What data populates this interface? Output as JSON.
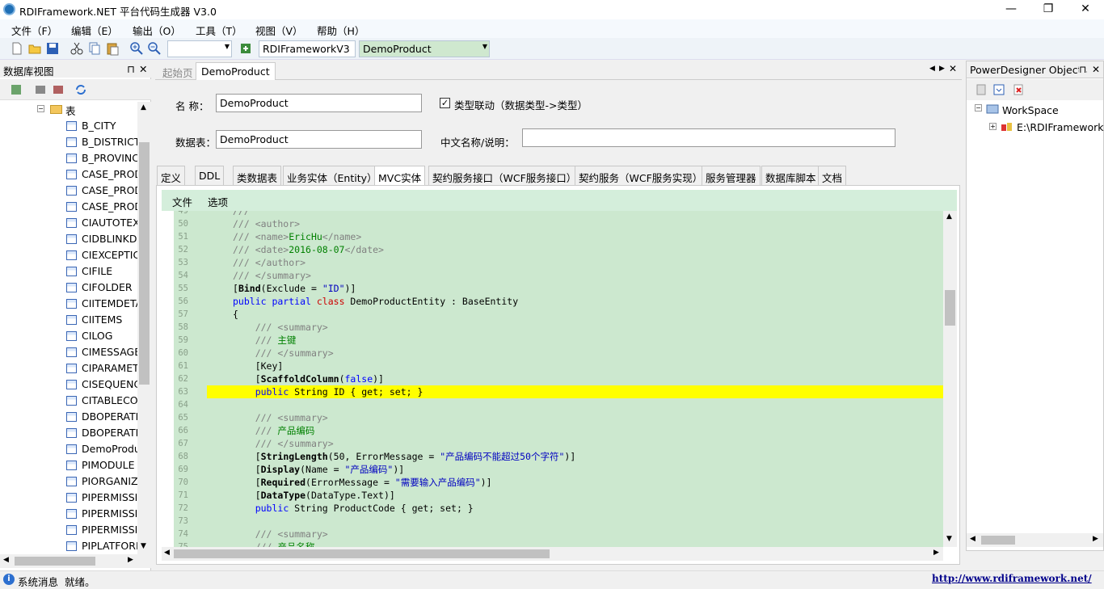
{
  "window": {
    "title": "RDIFramework.NET 平台代码生成器 V3.0",
    "minimize": "—",
    "maximize": "❐",
    "close": "✕"
  },
  "menu": [
    "文件（F）",
    "编辑（E）",
    "输出（O）",
    "工具（T）",
    "视图（V）",
    "帮助（H）"
  ],
  "toolbar": {
    "project_combo": "RDIFrameworkV3",
    "table_combo": "DemoProduct",
    "zoom_combo": ""
  },
  "left_panel": {
    "title": "数据库视图",
    "folder_label": "表",
    "tables": [
      "B_CITY",
      "B_DISTRICT",
      "B_PROVINC",
      "CASE_PROD",
      "CASE_PROD",
      "CASE_PROD",
      "CIAUTOTEX",
      "CIDBLINKDI",
      "CIEXCEPTIC",
      "CIFILE",
      "CIFOLDER",
      "CIITEMDETA",
      "CIITEMS",
      "CILOG",
      "CIMESSAGE",
      "CIPARAMET",
      "CISEQUENC",
      "CITABLECOI",
      "DBOPERATI",
      "DBOPERATI",
      "DemoProdu",
      "PIMODULE",
      "PIORGANIZ",
      "PIPERMISSI",
      "PIPERMISSI",
      "PIPERMISSI",
      "PIPLATFORN"
    ]
  },
  "doc_tabs": [
    "起始页",
    "DemoProduct"
  ],
  "form": {
    "name_label": "名 称：",
    "name_value": "DemoProduct",
    "checkbox_label": "类型联动（数据类型->类型）",
    "checkbox_checked": true,
    "table_label": "数据表：",
    "table_value": "DemoProduct",
    "desc_label": "中文名称/说明：",
    "desc_value": ""
  },
  "sub_tabs": [
    "定义",
    "DDL",
    "类数据表",
    "业务实体（Entity）",
    "MVC实体",
    "契约服务接口（WCF服务接口）",
    "契约服务（WCF服务实现）",
    "服务管理器",
    "数据库脚本",
    "文档"
  ],
  "active_sub_tab": "MVC实体",
  "editor_menu": [
    "文件",
    "选项"
  ],
  "code_lines": [
    {
      "n": "49",
      "html": "<span class='c-cm'>///</span>"
    },
    {
      "n": "50",
      "html": "<span class='c-cm'>/// &lt;author&gt;</span>"
    },
    {
      "n": "51",
      "html": "<span class='c-cm'>/// &lt;name&gt;</span><span class='c-zh'>EricHu</span><span class='c-cm'>&lt;/name&gt;</span>"
    },
    {
      "n": "52",
      "html": "<span class='c-cm'>/// &lt;date&gt;</span><span class='c-zh'>2016-08-07</span><span class='c-cm'>&lt;/date&gt;</span>"
    },
    {
      "n": "53",
      "html": "<span class='c-cm'>/// &lt;/author&gt;</span>"
    },
    {
      "n": "54",
      "html": "<span class='c-cm'>/// &lt;/summary&gt;</span>"
    },
    {
      "n": "55",
      "html": "[<span class='c-bold'>Bind</span>(Exclude = <span class='c-str'>\"ID\"</span>)]"
    },
    {
      "n": "56",
      "html": "<span class='c-kw'>public partial</span> <span class='c-cls'>class</span> DemoProductEntity : BaseEntity"
    },
    {
      "n": "57",
      "html": "{"
    },
    {
      "n": "58",
      "html": "    <span class='c-cm'>/// &lt;summary&gt;</span>"
    },
    {
      "n": "59",
      "html": "    <span class='c-cm'>///</span> <span class='c-zh'>主键</span>"
    },
    {
      "n": "60",
      "html": "    <span class='c-cm'>/// &lt;/summary&gt;</span>"
    },
    {
      "n": "61",
      "html": "    [Key]"
    },
    {
      "n": "62",
      "html": "    [<span class='c-bold'>ScaffoldColumn</span>(<span class='c-kw'>false</span>)]"
    },
    {
      "n": "63",
      "html": "    <span class='c-kw'>public</span> String ID { get; set; }",
      "highlight": true
    },
    {
      "n": "64",
      "html": ""
    },
    {
      "n": "65",
      "html": "    <span class='c-cm'>/// &lt;summary&gt;</span>"
    },
    {
      "n": "66",
      "html": "    <span class='c-cm'>///</span> <span class='c-zh'>产品编码</span>"
    },
    {
      "n": "67",
      "html": "    <span class='c-cm'>/// &lt;/summary&gt;</span>"
    },
    {
      "n": "68",
      "html": "    [<span class='c-bold'>StringLength</span>(50, ErrorMessage = <span class='c-str'>\"产品编码不能超过50个字符\"</span>)]"
    },
    {
      "n": "69",
      "html": "    [<span class='c-bold'>Display</span>(Name = <span class='c-str'>\"产品编码\"</span>)]"
    },
    {
      "n": "70",
      "html": "    [<span class='c-bold'>Required</span>(ErrorMessage = <span class='c-str'>\"需要输入产品编码\"</span>)]"
    },
    {
      "n": "71",
      "html": "    [<span class='c-bold'>DataType</span>(DataType.Text)]"
    },
    {
      "n": "72",
      "html": "    <span class='c-kw'>public</span> String ProductCode { get; set; }"
    },
    {
      "n": "73",
      "html": ""
    },
    {
      "n": "74",
      "html": "    <span class='c-cm'>/// &lt;summary&gt;</span>"
    },
    {
      "n": "75",
      "html": "    <span class='c-cm'>///</span> <span class='c-zh'>产品名称</span>"
    }
  ],
  "right_panel": {
    "title": "PowerDesigner Objects",
    "workspace": "WorkSpace",
    "file_node": "E:\\RDIFramework."
  },
  "status": {
    "label": "系统消息",
    "message": "就绪。",
    "link": "http://www.rdiframework.net/"
  }
}
